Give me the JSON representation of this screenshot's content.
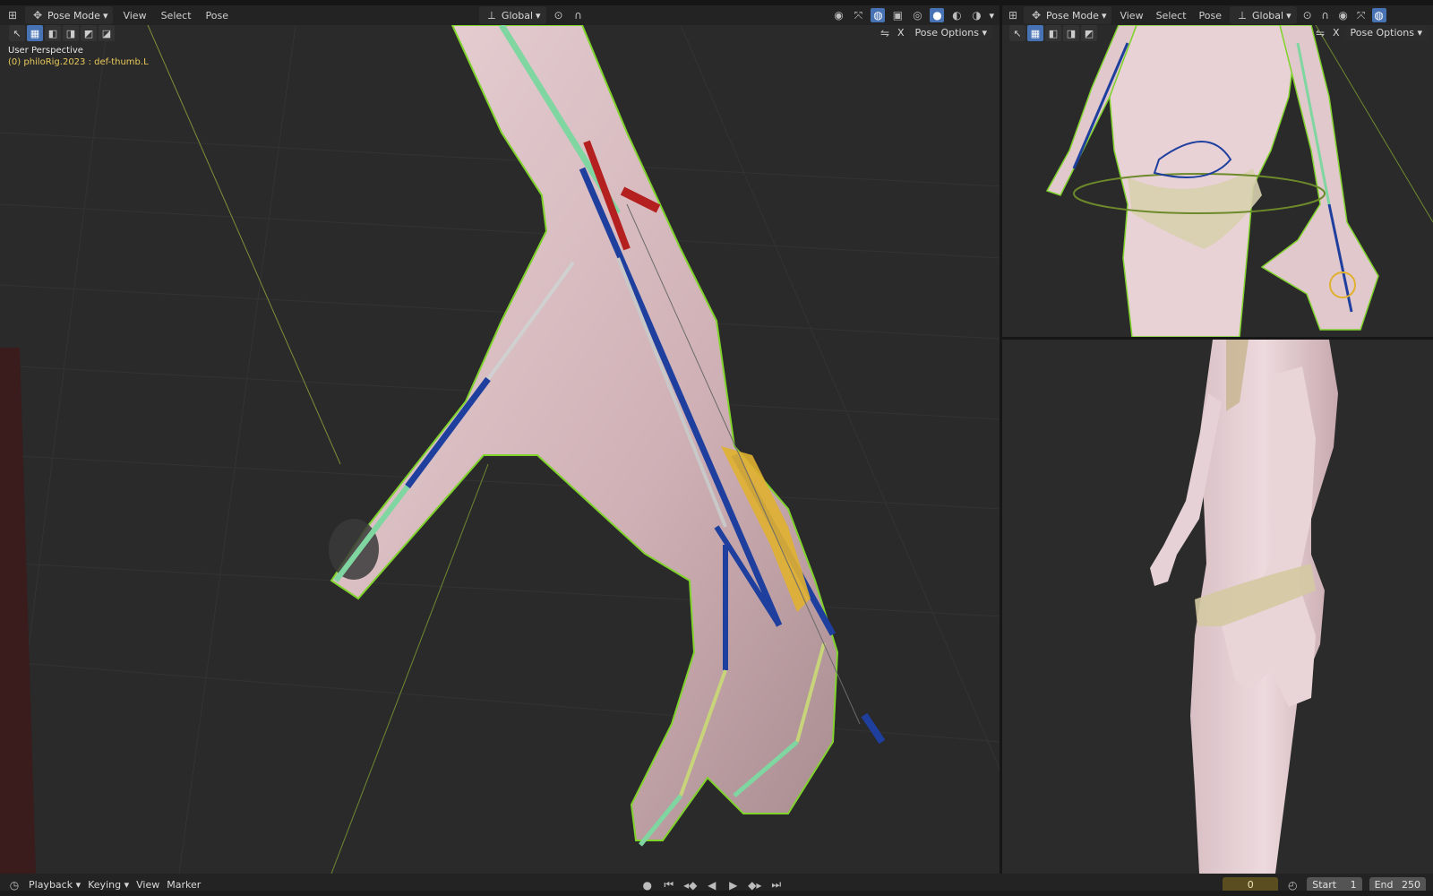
{
  "left": {
    "mode": "Pose Mode",
    "menus": [
      "View",
      "Select",
      "Pose"
    ],
    "orientation": "Global",
    "pose_options": "Pose Options",
    "overlay_title": "User Perspective",
    "overlay_object": "(0) philoRig.2023 : def-thumb.L",
    "x_label": "X"
  },
  "right": {
    "mode": "Pose Mode",
    "menus": [
      "View",
      "Select",
      "Pose"
    ],
    "orientation": "Global",
    "pose_options": "Pose Options",
    "x_label": "X"
  },
  "timeline": {
    "menus": [
      "Playback",
      "Keying",
      "View",
      "Marker"
    ],
    "current_frame": "0",
    "start_label": "Start",
    "start_value": "1",
    "end_label": "End",
    "end_value": "250"
  },
  "colors": {
    "accent": "#4772b3",
    "object_text": "#e8c95a",
    "mesh_outline": "#7fd32b",
    "bone_blue": "#1f3f9f",
    "bone_green": "#7fd6a0",
    "bone_red": "#b42020",
    "bone_gold": "#e0b030"
  }
}
